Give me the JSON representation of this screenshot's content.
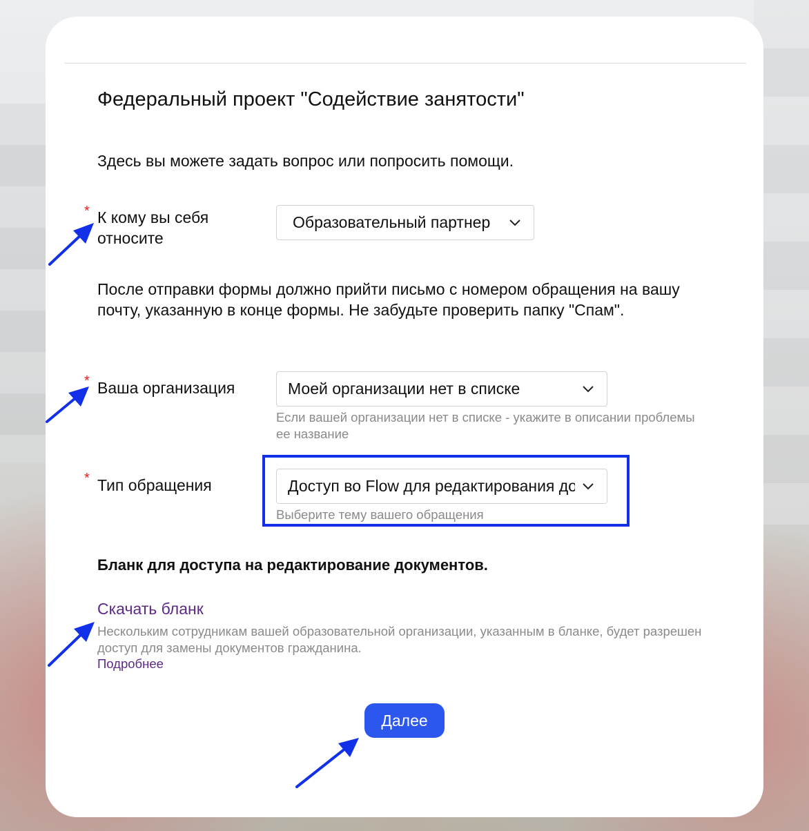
{
  "form": {
    "title": "Федеральный проект \"Содействие занятости\"",
    "intro": "Здесь вы можете задать вопрос или попросить помощи.",
    "required_mark": "*",
    "field_role": {
      "label": "К кому вы себя относите",
      "value": "Образовательный партнер"
    },
    "notice": "После отправки формы должно прийти письмо с номером обращения на вашу почту, указанную в конце формы. Не забудьте проверить папку \"Спам\".",
    "field_org": {
      "label": "Ваша организация",
      "value": "Моей организации нет в списке",
      "hint": "Если вашей организации нет в списке - укажите в описании проблемы ее название"
    },
    "field_type": {
      "label": "Тип обращения",
      "value": "Доступ во Flow для редактирования документов",
      "hint": "Выберите тему вашего обращения"
    },
    "blank_heading": "Бланк для доступа на редактирование документов.",
    "download_link": "Скачать бланк",
    "download_desc": "Нескольким сотрудникам вашей образовательной организации, указанным в бланке, будет разрешен доступ для замены документов гражданина.",
    "more_link": "Подробнее",
    "next_button": "Далее"
  },
  "colors": {
    "accent_button": "#2c57ee",
    "link": "#5b2a86",
    "required": "#f01b1b",
    "annotation": "#1230e8"
  },
  "icons": [
    "chevron-down-icon",
    "annotation-arrow-icon"
  ]
}
